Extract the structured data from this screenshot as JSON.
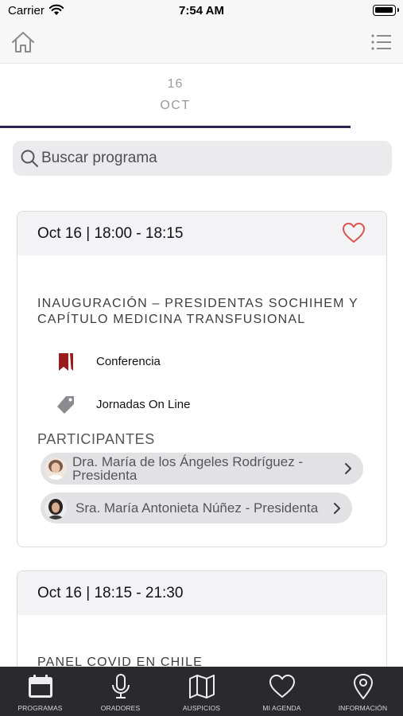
{
  "status_bar": {
    "carrier": "Carrier",
    "time": "7:54 AM"
  },
  "nav": {
    "home_icon": "home-icon",
    "menu_icon": "list-icon"
  },
  "date_tab": {
    "day": "16",
    "month": "OCT"
  },
  "search": {
    "placeholder": "Buscar programa",
    "value": ""
  },
  "sessions": [
    {
      "time": "Oct 16 | 18:00 - 18:15",
      "title": "INAUGURACIÓN – PRESIDENTAS SOCHIHEM Y CAPÍTULO MEDICINA TRANSFUSIONAL",
      "type": "Conferencia",
      "event": "Jornadas On Line",
      "participants_heading": "PARTICIPANTES",
      "participants": [
        {
          "name": "Dra. María de los Ángeles Rodríguez - Presidenta"
        },
        {
          "name": "Sra. María Antonieta Núñez - Presidenta"
        }
      ]
    },
    {
      "time": "Oct 16 | 18:15 - 21:30",
      "title": "PANEL COVID EN CHILE"
    }
  ],
  "tabs": [
    {
      "label": "PROGRAMAS",
      "icon": "calendar-icon"
    },
    {
      "label": "ORADORES",
      "icon": "microphone-icon"
    },
    {
      "label": "AUSPICIOS",
      "icon": "map-icon"
    },
    {
      "label": "MI AGENDA",
      "icon": "heart-icon"
    },
    {
      "label": "INFORMACIÓN",
      "icon": "location-pin-icon"
    }
  ],
  "colors": {
    "accent": "#2e2650",
    "favorite": "#d9534f",
    "type_icon": "#9b1c1c",
    "tab_bar": "#2a2a2c"
  }
}
